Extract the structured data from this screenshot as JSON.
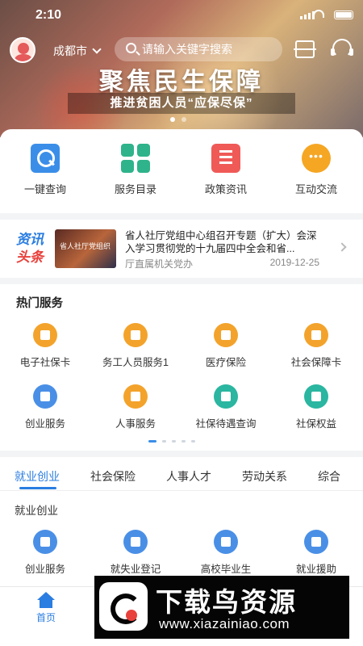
{
  "status_bar": {
    "time": "2:10"
  },
  "header": {
    "city": "成都市",
    "search_placeholder": "请输入关键字搜索"
  },
  "banner": {
    "title": "聚焦民生保障",
    "subtitle": "推进贫困人员“应保尽保”",
    "slides": 2,
    "active_slide": 1
  },
  "quick_actions": [
    {
      "label": "一键查询",
      "icon": "search-icon"
    },
    {
      "label": "服务目录",
      "icon": "grid-icon"
    },
    {
      "label": "政策资讯",
      "icon": "document-icon"
    },
    {
      "label": "互动交流",
      "icon": "chat-icon"
    }
  ],
  "news": {
    "badge_line1": "资讯",
    "badge_line2": "头条",
    "thumb_caption": "省人社厅党组织",
    "headline": "省人社厅党组中心组召开专题（扩大）会深入学习贯彻党的十九届四中全会和省...",
    "source": "厅直属机关党办",
    "date": "2019-12-25"
  },
  "hot_services": {
    "title": "热门服务",
    "items": [
      {
        "label": "电子社保卡",
        "icon": "id-card-icon",
        "color": "#f3a32b"
      },
      {
        "label": "务工人员服务1",
        "icon": "worker-icon",
        "color": "#f3a32b"
      },
      {
        "label": "医疗保险",
        "icon": "medical-kit-icon",
        "color": "#f3a32b"
      },
      {
        "label": "社会保障卡",
        "icon": "card-icon",
        "color": "#f3a32b"
      },
      {
        "label": "创业服务",
        "icon": "money-bag-icon",
        "color": "#4a8fe6"
      },
      {
        "label": "人事服务",
        "icon": "person-icon",
        "color": "#f3a32b"
      },
      {
        "label": "社保待遇查询",
        "icon": "benefit-search-icon",
        "color": "#2ab6a0"
      },
      {
        "label": "社保权益",
        "icon": "shield-icon",
        "color": "#2ab6a0"
      }
    ]
  },
  "category_tabs": {
    "tabs": [
      "就业创业",
      "社会保险",
      "人事人才",
      "劳动关系",
      "综合"
    ],
    "active": "就业创业",
    "section_title": "就业创业",
    "items": [
      {
        "label": "创业服务",
        "icon": "money-bag-icon",
        "color": "#4a8fe6"
      },
      {
        "label": "就失业登记",
        "icon": "briefcase-icon",
        "color": "#4a8fe6"
      },
      {
        "label": "高校毕业生",
        "icon": "graduation-cap-icon",
        "color": "#4a8fe6"
      },
      {
        "label": "就业援助",
        "icon": "help-form-icon",
        "color": "#4a8fe6"
      }
    ]
  },
  "tabbar": {
    "home_label": "首页"
  },
  "watermark": {
    "title": "下载鸟资源",
    "url": "www.xiazainiao.com"
  },
  "colors": {
    "primary": "#2a7de1",
    "orange": "#f3a32b",
    "teal": "#2ab6a0",
    "red": "#ef5a57"
  }
}
